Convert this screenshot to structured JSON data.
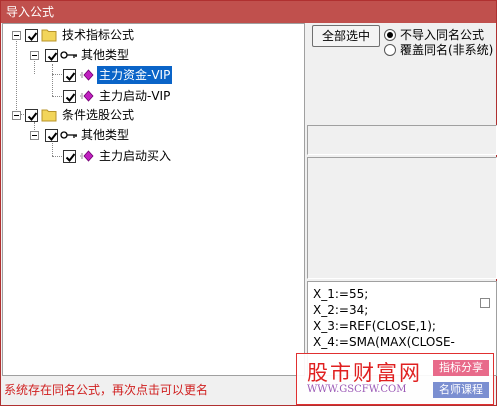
{
  "window": {
    "title": "导入公式"
  },
  "tree": {
    "groups": [
      {
        "label": "技术指标公式",
        "checked": true,
        "subgroup": {
          "label": "其他类型",
          "checked": true,
          "items": [
            {
              "label": "主力资金-VIP",
              "checked": true,
              "selected": true
            },
            {
              "label": "主力启动-VIP",
              "checked": true,
              "selected": false
            }
          ]
        }
      },
      {
        "label": "条件选股公式",
        "checked": true,
        "subgroup": {
          "label": "其他类型",
          "checked": true,
          "items": [
            {
              "label": "主力启动买入",
              "checked": true,
              "selected": false
            }
          ]
        }
      }
    ]
  },
  "options": {
    "select_all_label": "全部选中",
    "radio_no_import": "不导入同名公式",
    "radio_overwrite": "覆盖同名(非系统)",
    "selected_radio": "no_import"
  },
  "code_preview": {
    "lines": [
      "X_1:=55;",
      "X_2:=34;",
      "X_3:=REF(CLOSE,1);",
      "X_4:=SMA(MAX(CLOSE-"
    ]
  },
  "status": {
    "message": "系统存在同名公式，再次点击可以更名"
  },
  "watermark": {
    "title": "股市财富网",
    "url": "WWW.GSCFW.COM",
    "tag1": "指标分享",
    "tag2": "名师课程"
  },
  "colors": {
    "titlebar": "#c0504d",
    "selection": "#0a64c8",
    "status_text": "#d02020",
    "folder": "#f2d55a",
    "formula_icon": "#c020c0"
  },
  "icons": [
    "folder-icon",
    "key-icon",
    "formula-icon",
    "check-icon"
  ]
}
